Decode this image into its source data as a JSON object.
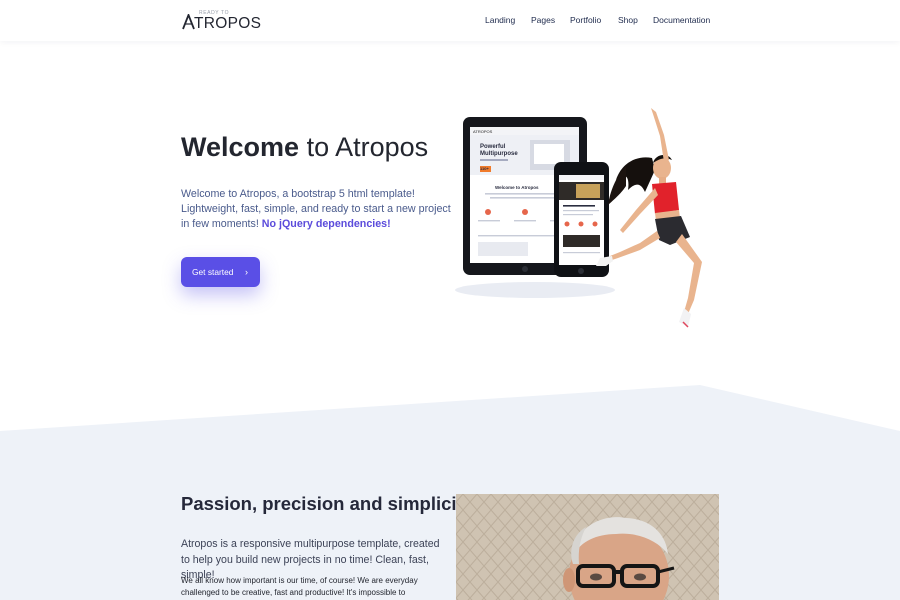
{
  "logo": {
    "tagline": "READY TO",
    "name": "ATROPOS"
  },
  "nav": [
    {
      "label": "Landing"
    },
    {
      "label": "Pages"
    },
    {
      "label": "Portfolio"
    },
    {
      "label": "Shop"
    },
    {
      "label": "Documentation"
    }
  ],
  "hero": {
    "title_bold": "Welcome",
    "title_rest": "to Atropos",
    "text": "Welcome to Atropos, a bootstrap 5 html template! Lightweight, fast, simple, and ready to start a new project in few moments!",
    "text_strong": "No jQuery dependencies!",
    "button_label": "Get started",
    "button_icon": "chevron-right-icon"
  },
  "device_mockup": {
    "logo": "ATROPOS",
    "headline": "Powerful Multipurpose",
    "badge": "110+",
    "welcome": "Welcome to Atropos"
  },
  "section2": {
    "title": "Passion, precision and simplicity",
    "lead": "Atropos is a responsive multipurpose template, created to help you build new projects in no time! Clean, fast, simple!",
    "body": "We all know how important is our time, of course! We are everyday challenged to be creative, fast and productive! It's impossible to"
  },
  "colors": {
    "accent": "#5a4fe6",
    "nav_text": "#1f2b4d",
    "hero_text": "#4a5b8c",
    "section_bg": "#eef2f8"
  }
}
